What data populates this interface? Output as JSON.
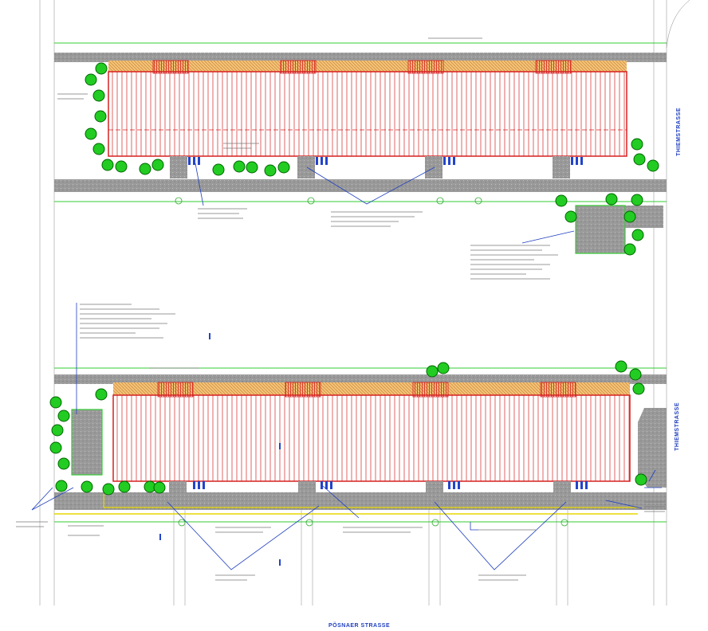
{
  "streets": {
    "right_upper": "THIEMSTRASSE",
    "right_lower": "THIEMSTRASSE",
    "bottom": "PÖSNAER STRASSE"
  },
  "colors": {
    "building_outline": "#d62020",
    "building_stripes": "#d62020",
    "roof_hatch": "#e0a040",
    "tree_fill": "#22cc22",
    "tree_outline": "#006600",
    "boundary_green": "#33cc33",
    "paving_grey": "#9a9a9a",
    "annotation_blue": "#1f3fbf",
    "parking_blue": "#2244cc",
    "yellow_line": "#e6d800",
    "construction_line": "#555555"
  },
  "buildings": [
    {
      "name": "upper-building",
      "stair_cores": 4,
      "parking_clusters": 4
    },
    {
      "name": "lower-building",
      "stair_cores": 4,
      "parking_clusters": 4
    }
  ],
  "icons": [
    "tree-symbol",
    "lamp-post-symbol",
    "bicycle-parking-symbol"
  ]
}
